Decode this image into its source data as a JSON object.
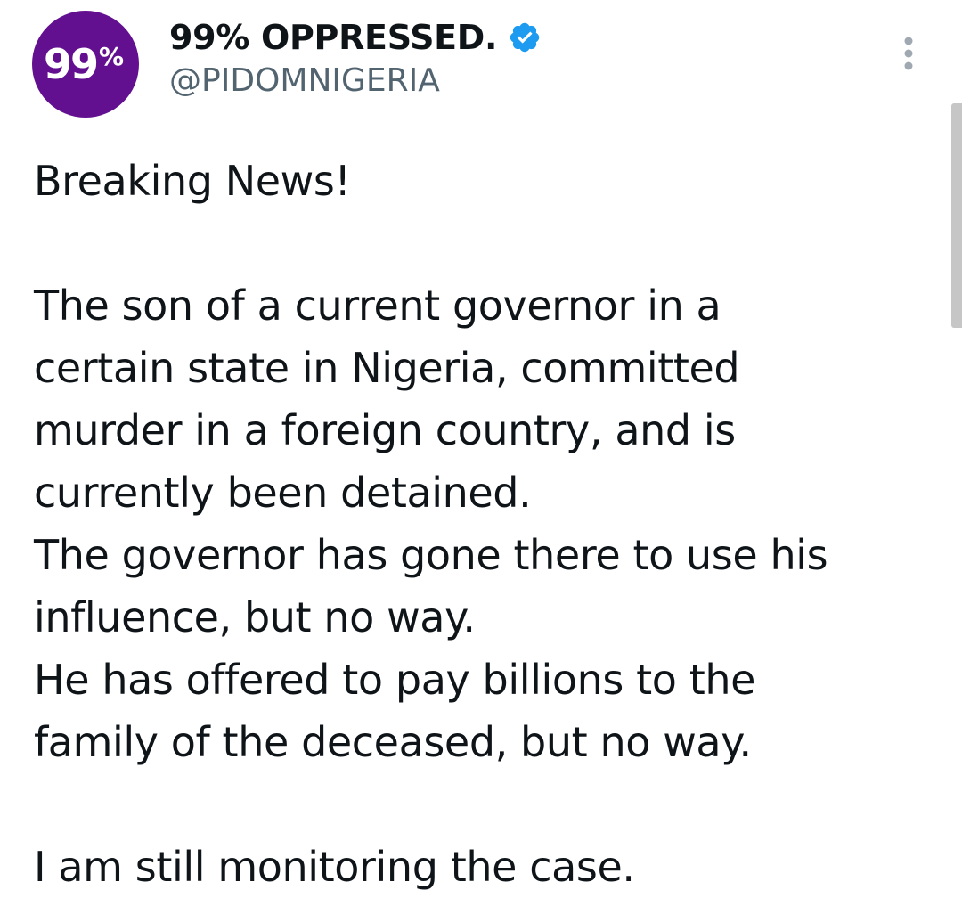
{
  "author": {
    "avatar_text": "99",
    "avatar_percent": "%",
    "display_name": "99% OPPRESSED.",
    "handle": "@PIDOMNIGERIA",
    "verified": true,
    "avatar_color": "#62108f",
    "verified_color": "#1d9bf0"
  },
  "menu": {
    "icon": "more-vertical-icon"
  },
  "tweet": {
    "lines": [
      "Breaking News!",
      "",
      "The son of a current governor in a",
      "certain state in Nigeria, committed",
      "murder in a foreign country, and is",
      "currently been detained.",
      "The governor has gone there to use his",
      "influence, but no way.",
      "He has offered to pay billions to the",
      "family of the deceased, but no way.",
      "",
      "I am still monitoring the case."
    ]
  }
}
